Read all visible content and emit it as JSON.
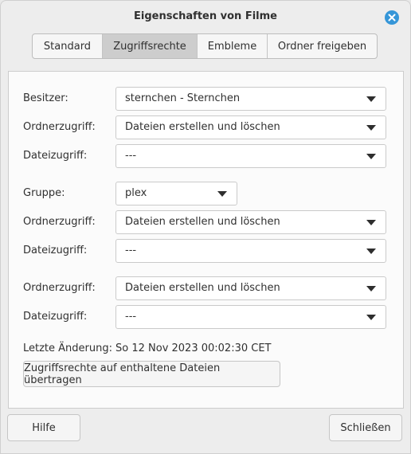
{
  "window": {
    "title": "Eigenschaften von Filme"
  },
  "tabs": [
    {
      "label": "Standard",
      "active": false
    },
    {
      "label": "Zugriffsrechte",
      "active": true
    },
    {
      "label": "Embleme",
      "active": false
    },
    {
      "label": "Ordner freigeben",
      "active": false
    }
  ],
  "owner": {
    "label": "Besitzer:",
    "value": "sternchen - Sternchen",
    "folder_access_label": "Ordnerzugriff:",
    "folder_access_value": "Dateien erstellen und löschen",
    "file_access_label": "Dateizugriff:",
    "file_access_value": "---"
  },
  "group": {
    "label": "Gruppe:",
    "value": "plex",
    "folder_access_label": "Ordnerzugriff:",
    "folder_access_value": "Dateien erstellen und löschen",
    "file_access_label": "Dateizugriff:",
    "file_access_value": "---"
  },
  "others": {
    "folder_access_label": "Ordnerzugriff:",
    "folder_access_value": "Dateien erstellen und löschen",
    "file_access_label": "Dateizugriff:",
    "file_access_value": "---"
  },
  "last_change": {
    "label": "Letzte Änderung:",
    "value": "So 12 Nov 2023 00:02:30 CET"
  },
  "apply_button": "Zugriffsrechte auf enthaltene Dateien übertragen",
  "footer": {
    "help_button": "Hilfe",
    "close_button": "Schließen"
  },
  "colors": {
    "accent": "#3596d8",
    "active_tab": "#cdcdcd",
    "panel_bg": "#fbfbfb"
  }
}
